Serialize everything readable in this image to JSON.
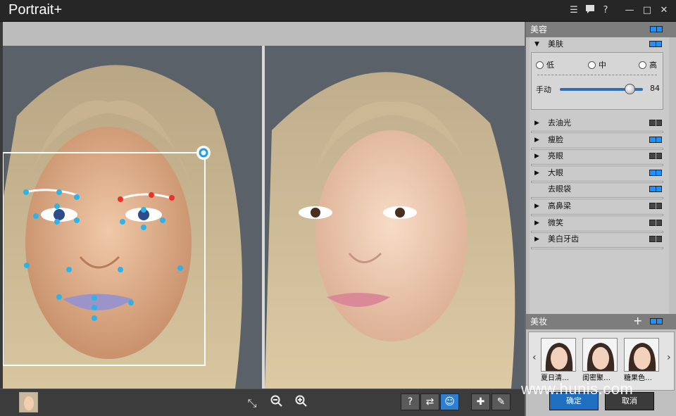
{
  "app": {
    "title": "Portrait+"
  },
  "titlebar": {
    "list_icon": "list-icon",
    "chat_icon": "chat-icon",
    "help_label": "?",
    "minimize_label": "—",
    "maximize_label": "□",
    "close_label": "✕"
  },
  "panel": {
    "beauty": {
      "title": "美容",
      "skin": {
        "label": "美肤",
        "levels": [
          "低",
          "中",
          "高"
        ],
        "manual_label": "手动",
        "manual_value": 84,
        "manual_max": 100
      },
      "items": [
        {
          "label": "去油光",
          "expanded": false,
          "on": false
        },
        {
          "label": "瘦脸",
          "expanded": false,
          "on": true
        },
        {
          "label": "亮眼",
          "expanded": false,
          "on": false
        },
        {
          "label": "大眼",
          "expanded": false,
          "on": true
        },
        {
          "label": "去眼袋",
          "expanded": false,
          "on": true
        },
        {
          "label": "高鼻梁",
          "expanded": false,
          "on": false
        },
        {
          "label": "微笑",
          "expanded": false,
          "on": false
        },
        {
          "label": "美白牙齿",
          "expanded": false,
          "on": false
        }
      ]
    },
    "makeup": {
      "title": "美妆",
      "add_label": "+",
      "looks": [
        "夏日清…",
        "闺密聚…",
        "糖果色…"
      ]
    },
    "ok_label": "确定",
    "cancel_label": "取消"
  },
  "toolbar": {
    "help_label": "?",
    "compare_icon": "swap-icon",
    "face_icon": "smile-icon",
    "bandage_icon": "bandage-icon",
    "brush_icon": "brush-icon"
  },
  "watermark": "www.hunis.com"
}
